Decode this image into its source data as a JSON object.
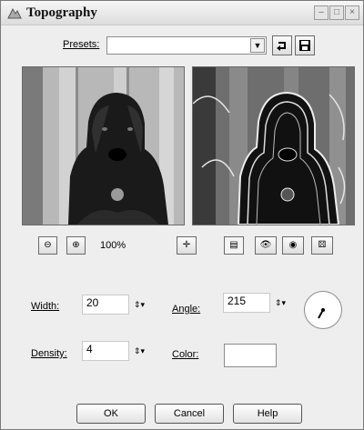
{
  "window": {
    "title": "Topography"
  },
  "presets": {
    "label": "Presets:",
    "value": ""
  },
  "zoom": {
    "level": "100%"
  },
  "params": {
    "width_label": "Width:",
    "width_value": "20",
    "angle_label": "Angle:",
    "angle_value": "215",
    "density_label": "Density:",
    "density_value": "4",
    "color_label": "Color:"
  },
  "buttons": {
    "ok": "OK",
    "cancel": "Cancel",
    "help": "Help"
  },
  "icons": {
    "title": "topography-icon",
    "presets_reset": "reset-arrow-icon",
    "presets_save": "save-icon",
    "zoom_out": "zoom-out-icon",
    "zoom_in": "zoom-in-icon",
    "move": "move-icon",
    "preview_toggle": "preview-toggle-icon",
    "proof": "proof-icon",
    "auto_proof": "auto-proof-icon",
    "randomize": "randomize-icon"
  }
}
